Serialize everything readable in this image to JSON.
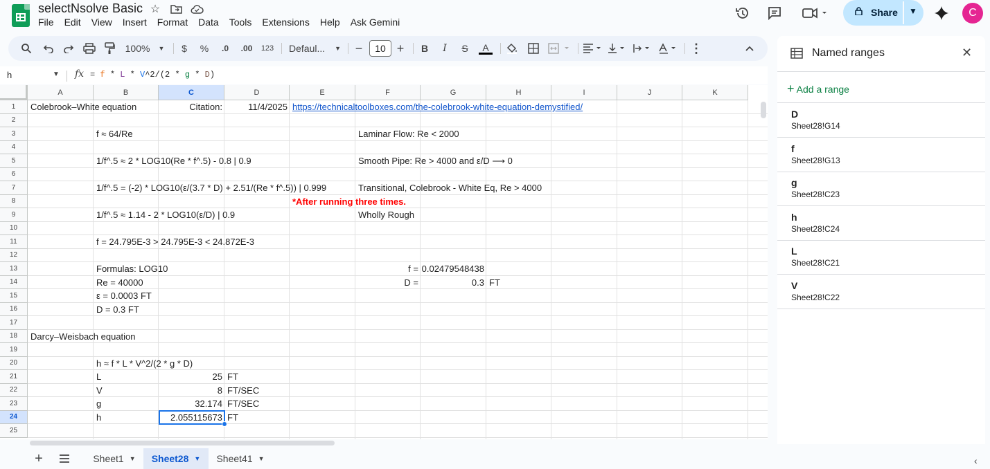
{
  "title": "selectNsolve Basic",
  "menu": [
    "File",
    "Edit",
    "View",
    "Insert",
    "Format",
    "Data",
    "Tools",
    "Extensions",
    "Help",
    "Ask Gemini"
  ],
  "share_label": "Share",
  "avatar_letter": "C",
  "toolbar": {
    "zoom": "100%",
    "currency": "$",
    "percent": "%",
    "dec_decrease": ".0",
    "dec_increase": ".00",
    "number_format": "123",
    "font": "Defaul...",
    "font_size": "10",
    "bold": "B",
    "italic": "I",
    "strike": "S",
    "text_color": "A"
  },
  "formula_bar": {
    "name_box": "h",
    "fx": "fx",
    "formula_parts": [
      "=",
      "f",
      "*",
      "L",
      "*",
      "V",
      "^2/(2 *",
      "g",
      "*",
      "D",
      ")"
    ]
  },
  "grid": {
    "columns": [
      "A",
      "B",
      "C",
      "D",
      "E",
      "F",
      "G",
      "H",
      "I",
      "J",
      "K"
    ],
    "rows": [
      "1",
      "2",
      "3",
      "4",
      "5",
      "6",
      "7",
      "8",
      "9",
      "10",
      "11",
      "12",
      "13",
      "14",
      "15",
      "16",
      "17",
      "18",
      "19",
      "20",
      "21",
      "22",
      "23",
      "24",
      "25"
    ],
    "cells": {
      "A1": "Colebrook–White equation",
      "C1": "Citation:",
      "D1": "11/4/2025",
      "E1": "https://technicaltoolboxes.com/the-colebrook-white-equation-demystified/",
      "B3": "f ≈ 64/Re",
      "F3": "Laminar Flow: Re < 2000",
      "B5": "1/f^.5 ≈ 2 * LOG10(Re * f^.5) - 0.8 | 0.9",
      "F5": "Smooth Pipe: Re > 4000 and ε/D ⟶ 0",
      "B7": "1/f^.5 = (-2) * LOG10(ε/(3.7 * D) + 2.51/(Re * f^.5)) | 0.999",
      "F7": "Transitional, Colebrook - White Eq, Re > 4000",
      "E8": "*After running three times.",
      "B9": "1/f^.5 ≈ 1.14 - 2 * LOG10(ε/D) | 0.9",
      "F9": "Wholly Rough",
      "B11": "f = 24.795E-3  > 24.795E-3 < 24.872E-3",
      "B13": "Formulas: LOG10",
      "F13": "f =",
      "G13": "0.02479548438",
      "B14": "Re = 40000",
      "F14": "D =",
      "G14": "0.3",
      "H14": "FT",
      "B15": "ε = 0.0003 FT",
      "B16": "D = 0.3 FT",
      "A18": "Darcy–Weisbach equation",
      "B20": "h ≈ f * L * V^2/(2 * g * D)",
      "B21": "L",
      "C21": "25",
      "D21": "FT",
      "B22": "V",
      "C22": "8",
      "D22": "FT/SEC",
      "B23": "g",
      "C23": "32.174",
      "D23": "FT/SEC",
      "B24": "h",
      "C24": "2.055115673",
      "D24": "FT"
    }
  },
  "sheet_tabs": [
    "Sheet1",
    "Sheet28",
    "Sheet41"
  ],
  "active_sheet": "Sheet28",
  "named_ranges_panel": {
    "title": "Named ranges",
    "add_label": "Add a range",
    "items": [
      {
        "name": "D",
        "range": "Sheet28!G14"
      },
      {
        "name": "f",
        "range": "Sheet28!G13"
      },
      {
        "name": "g",
        "range": "Sheet28!C23"
      },
      {
        "name": "h",
        "range": "Sheet28!C24"
      },
      {
        "name": "L",
        "range": "Sheet28!C21"
      },
      {
        "name": "V",
        "range": "Sheet28!C22"
      }
    ]
  },
  "colors": {
    "accent": "#1a73e8",
    "share_bg": "#c2e7ff",
    "avatar_bg": "#e52592",
    "warning_text": "#ff0000",
    "link": "#1155cc"
  }
}
